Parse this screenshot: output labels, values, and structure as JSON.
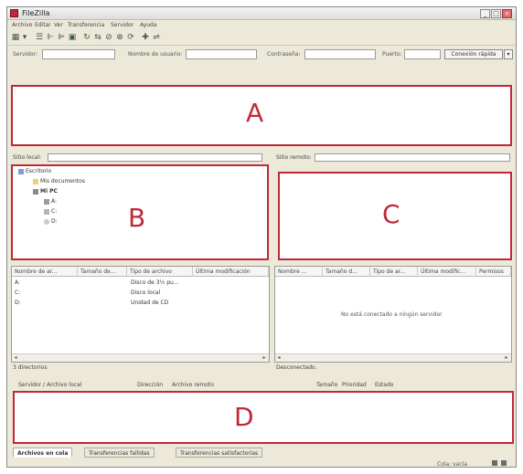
{
  "window": {
    "title": "FileZilla"
  },
  "menu": [
    "Archivo",
    "Editar",
    "Ver",
    "Transferencia",
    "Servidor",
    "Ayuda"
  ],
  "toolbar": {
    "icons": [
      "site-manager-icon",
      "dropdown-icon",
      "message-log-icon",
      "local-tree-icon",
      "remote-tree-icon",
      "queue-icon",
      "refresh-icon",
      "process-queue-icon",
      "cancel-icon",
      "disconnect-icon",
      "reconnect-icon",
      "filter-icon",
      "compare-icon"
    ]
  },
  "quickconnect": {
    "host_label": "Servidor:",
    "user_label": "Nombre de usuario:",
    "pass_label": "Contraseña:",
    "port_label": "Puerto:",
    "connect_label": "Conexión rápida",
    "dropdown_glyph": "▾"
  },
  "regions": {
    "a": "A",
    "b": "B",
    "c": "C",
    "d": "D"
  },
  "local": {
    "site_label": "Sitio local:",
    "tree": [
      {
        "label": "Escritorio",
        "indent": 0
      },
      {
        "label": "Mis documentos",
        "indent": 1
      },
      {
        "label": "Mi PC",
        "indent": 1
      },
      {
        "label": "A:",
        "indent": 2
      },
      {
        "label": "C:",
        "indent": 2
      },
      {
        "label": "D:",
        "indent": 2
      }
    ],
    "columns": [
      "Nombre de ar...",
      "Tamaño de...",
      "Tipo de archivo",
      "Última modificación"
    ],
    "rows": [
      {
        "name": "A:",
        "type": "Disco de 3½ pu..."
      },
      {
        "name": "C:",
        "type": "Disco local"
      },
      {
        "name": "D:",
        "type": "Unidad de CD"
      }
    ],
    "status": "3 directorios"
  },
  "remote": {
    "site_label": "Sitio remoto:",
    "columns": [
      "Nombre ...",
      "Tamaño d...",
      "Tipo de ar...",
      "Última modific...",
      "Permisos"
    ],
    "empty_message": "No está conectado a ningún servidor",
    "status": "Desconectado."
  },
  "queue": {
    "columns": [
      "Servidor / Archivo local",
      "Dirección",
      "Archivo remoto",
      "Tamaño",
      "Prioridad",
      "Estado"
    ],
    "tabs": [
      "Archivos en cola",
      "Transferencias fallidas",
      "Transferencias satisfactorias"
    ]
  },
  "statusbar": {
    "text": "Cola: vacía"
  }
}
